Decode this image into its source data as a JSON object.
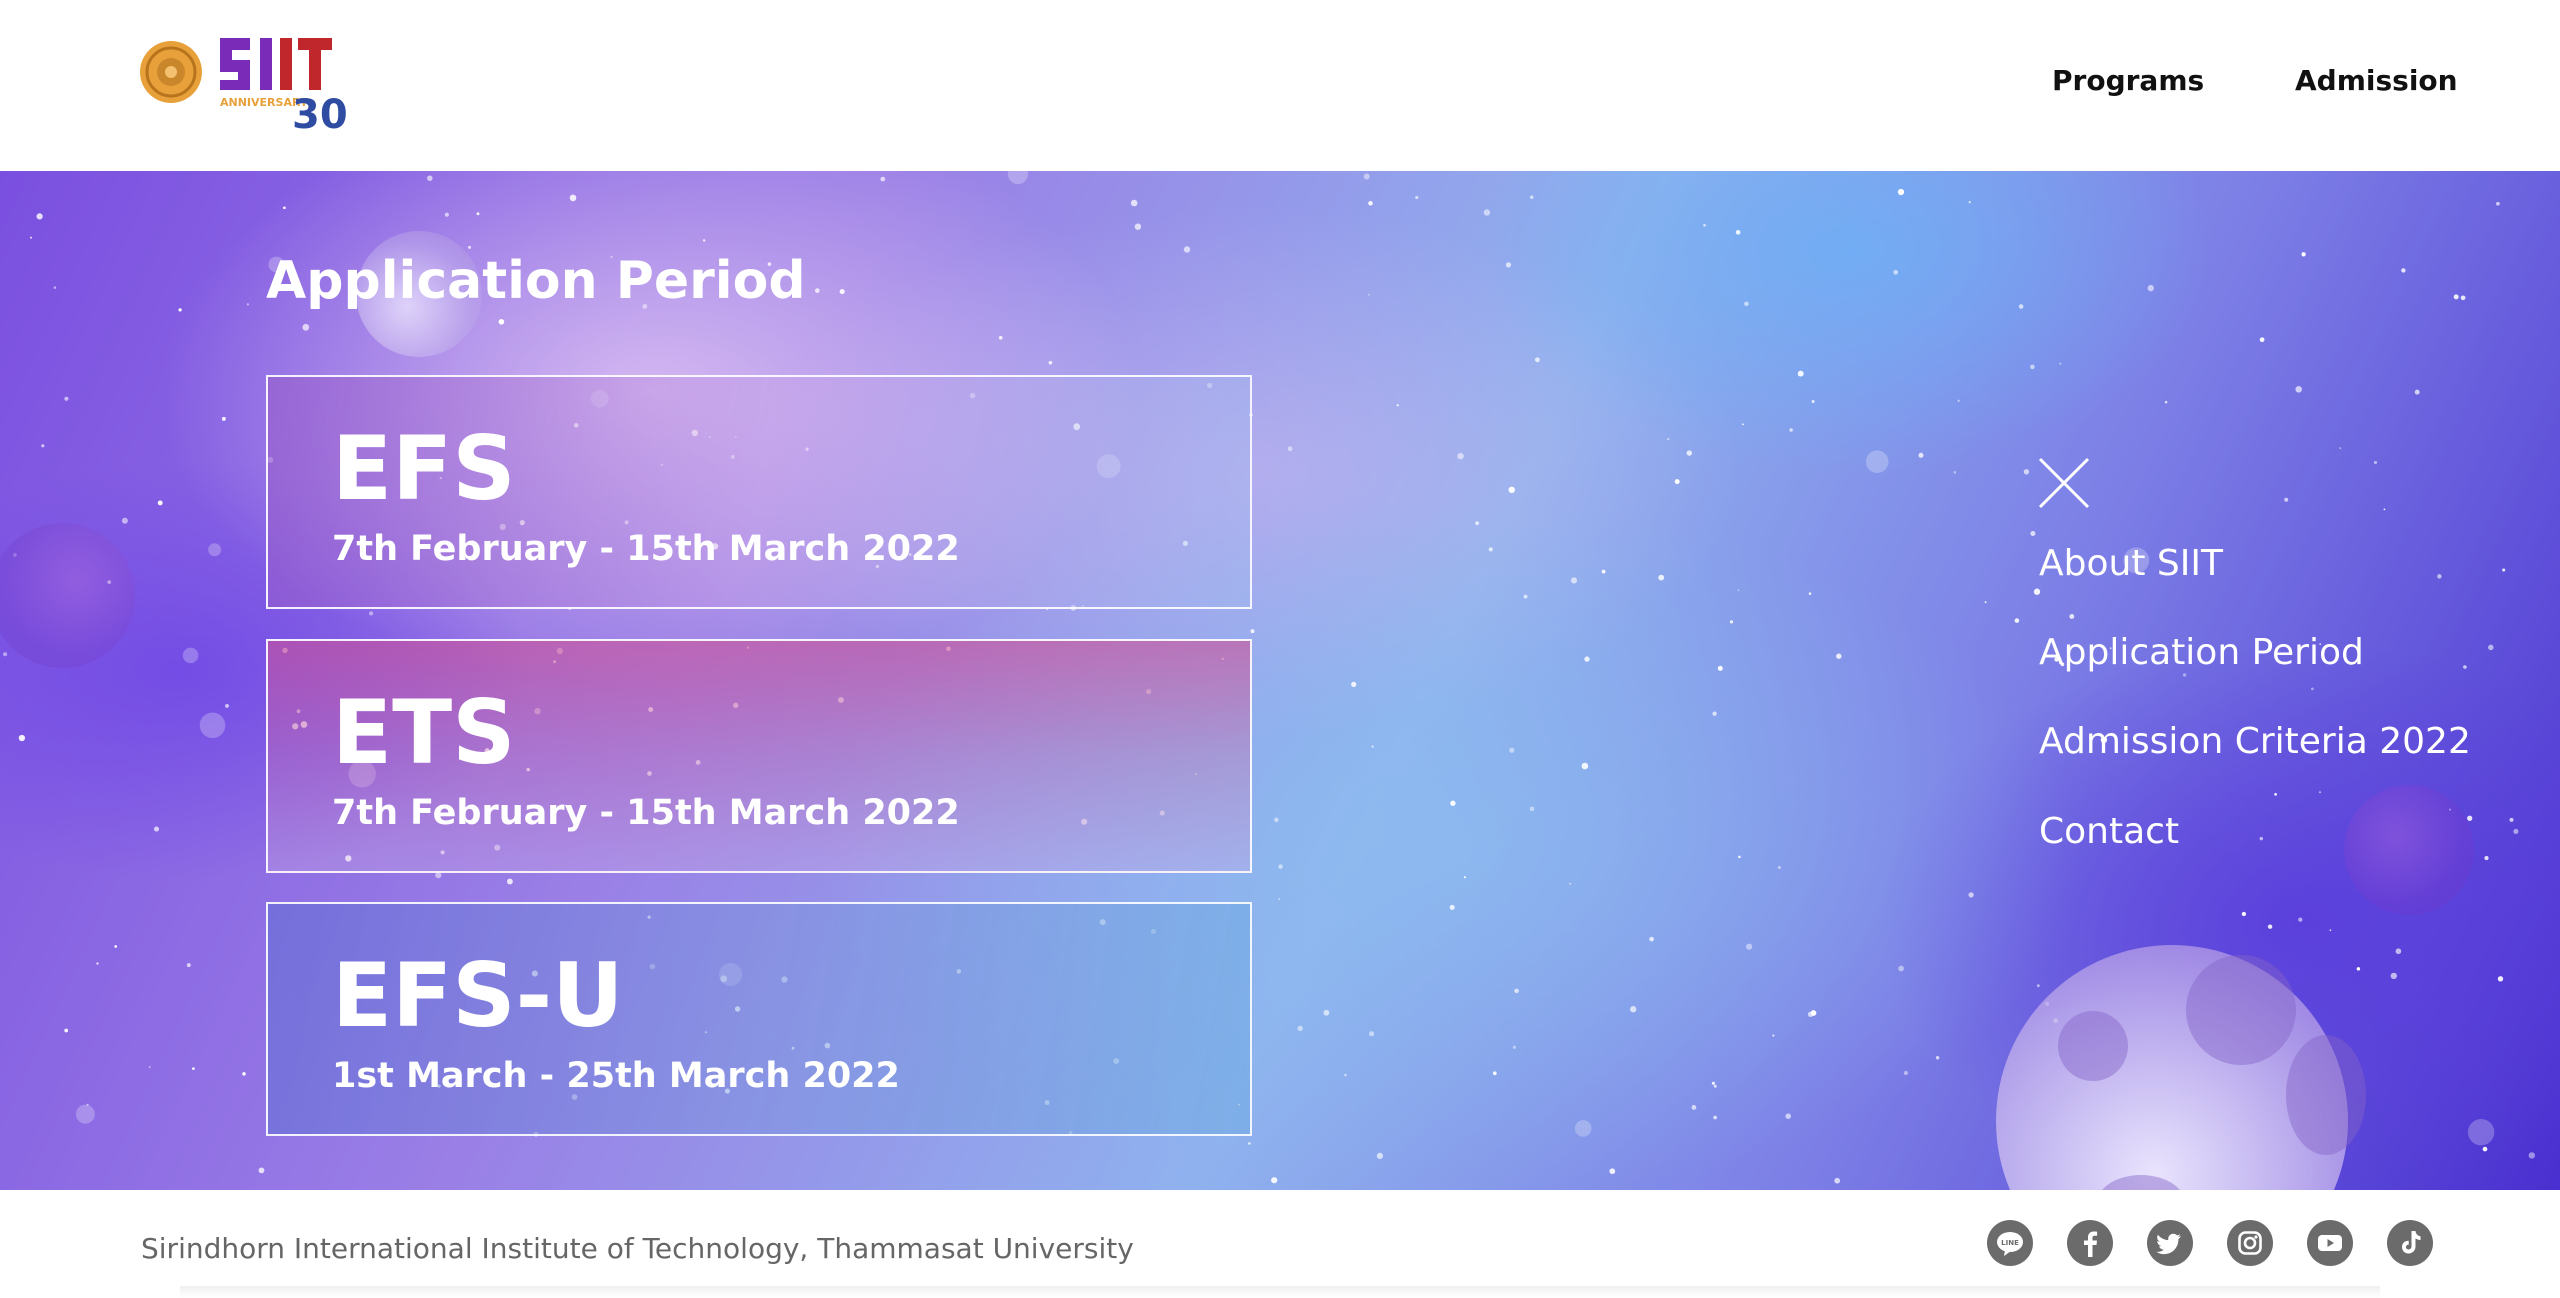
{
  "header": {
    "nav": [
      {
        "label": "Programs"
      },
      {
        "label": "Admission"
      }
    ]
  },
  "hero": {
    "title": "Application Period",
    "cards": [
      {
        "code": "EFS",
        "dates": "7th February - 15th March 2022"
      },
      {
        "code": "ETS",
        "dates": "7th February - 15th March 2022"
      },
      {
        "code": "EFS-U",
        "dates": "1st March - 25th March 2022"
      }
    ]
  },
  "side_menu": {
    "items": [
      {
        "label": "About SIIT"
      },
      {
        "label": "Application Period"
      },
      {
        "label": "Admission Criteria 2022"
      },
      {
        "label": "Contact"
      }
    ]
  },
  "footer": {
    "text": "Sirindhorn International Institute of Technology, Thammasat University",
    "social": [
      {
        "icon": "line-icon",
        "label": "LINE"
      },
      {
        "icon": "facebook-icon"
      },
      {
        "icon": "twitter-icon"
      },
      {
        "icon": "instagram-icon"
      },
      {
        "icon": "youtube-icon"
      },
      {
        "icon": "tiktok-icon"
      }
    ]
  },
  "logo": {
    "text": "SIIT",
    "sub": "ANNIVERSARY",
    "number": "30"
  },
  "colors": {
    "logo_purple": "#7a2bb8",
    "logo_red": "#c0272d",
    "logo_gold": "#e8a13a",
    "footer_icon": "#6b6b6b"
  }
}
